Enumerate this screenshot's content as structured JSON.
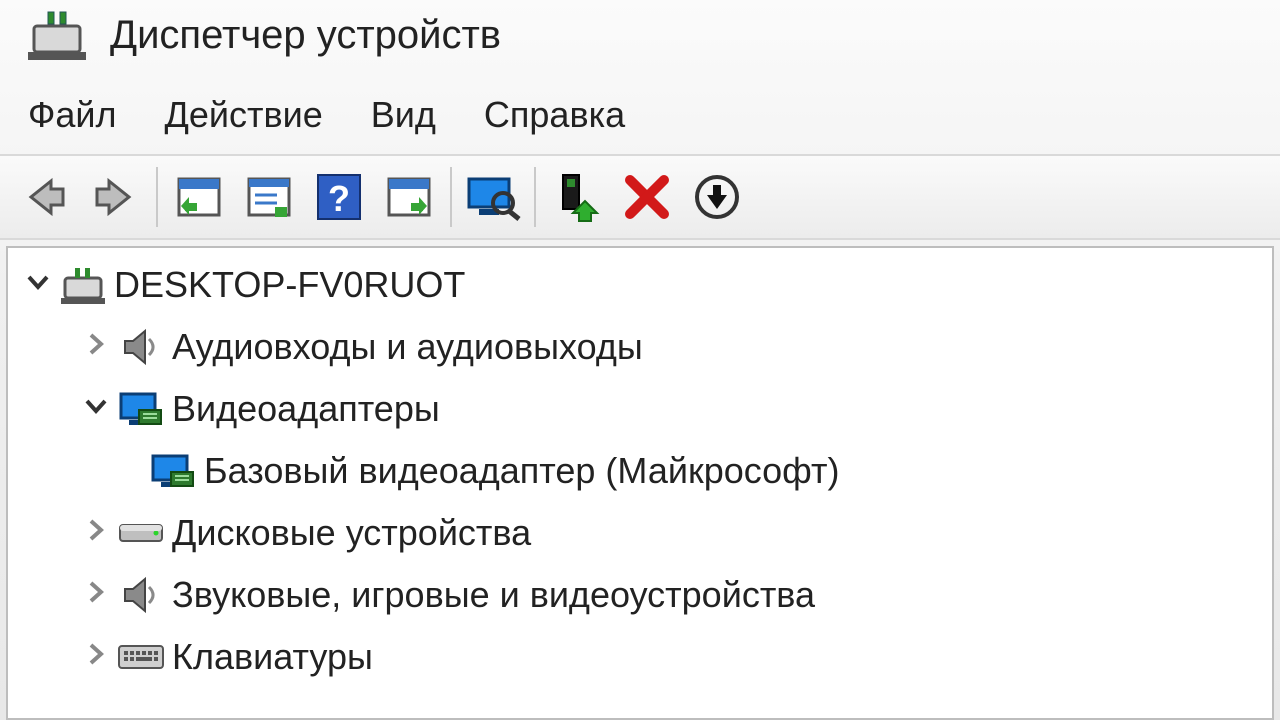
{
  "window": {
    "title": "Диспетчер устройств"
  },
  "menu": {
    "file": "Файл",
    "action": "Действие",
    "view": "Вид",
    "help": "Справка"
  },
  "toolbar": {
    "back": "Назад",
    "forward": "Вперёд",
    "show_hidden": "Показать скрытые",
    "properties": "Свойства",
    "help": "Справка",
    "refresh": "Обновить",
    "scan": "Сканировать",
    "update_driver": "Обновить драйвер",
    "remove": "Удалить",
    "down": "Вниз"
  },
  "tree": {
    "root": "DESKTOP-FV0RUOT",
    "audio_io": "Аудиовходы и аудиовыходы",
    "display_adapters": "Видеоадаптеры",
    "basic_display": "Базовый видеоадаптер (Майкрософт)",
    "disk_drives": "Дисковые устройства",
    "sound_game_video": "Звуковые, игровые и видеоустройства",
    "keyboards": "Клавиатуры"
  }
}
